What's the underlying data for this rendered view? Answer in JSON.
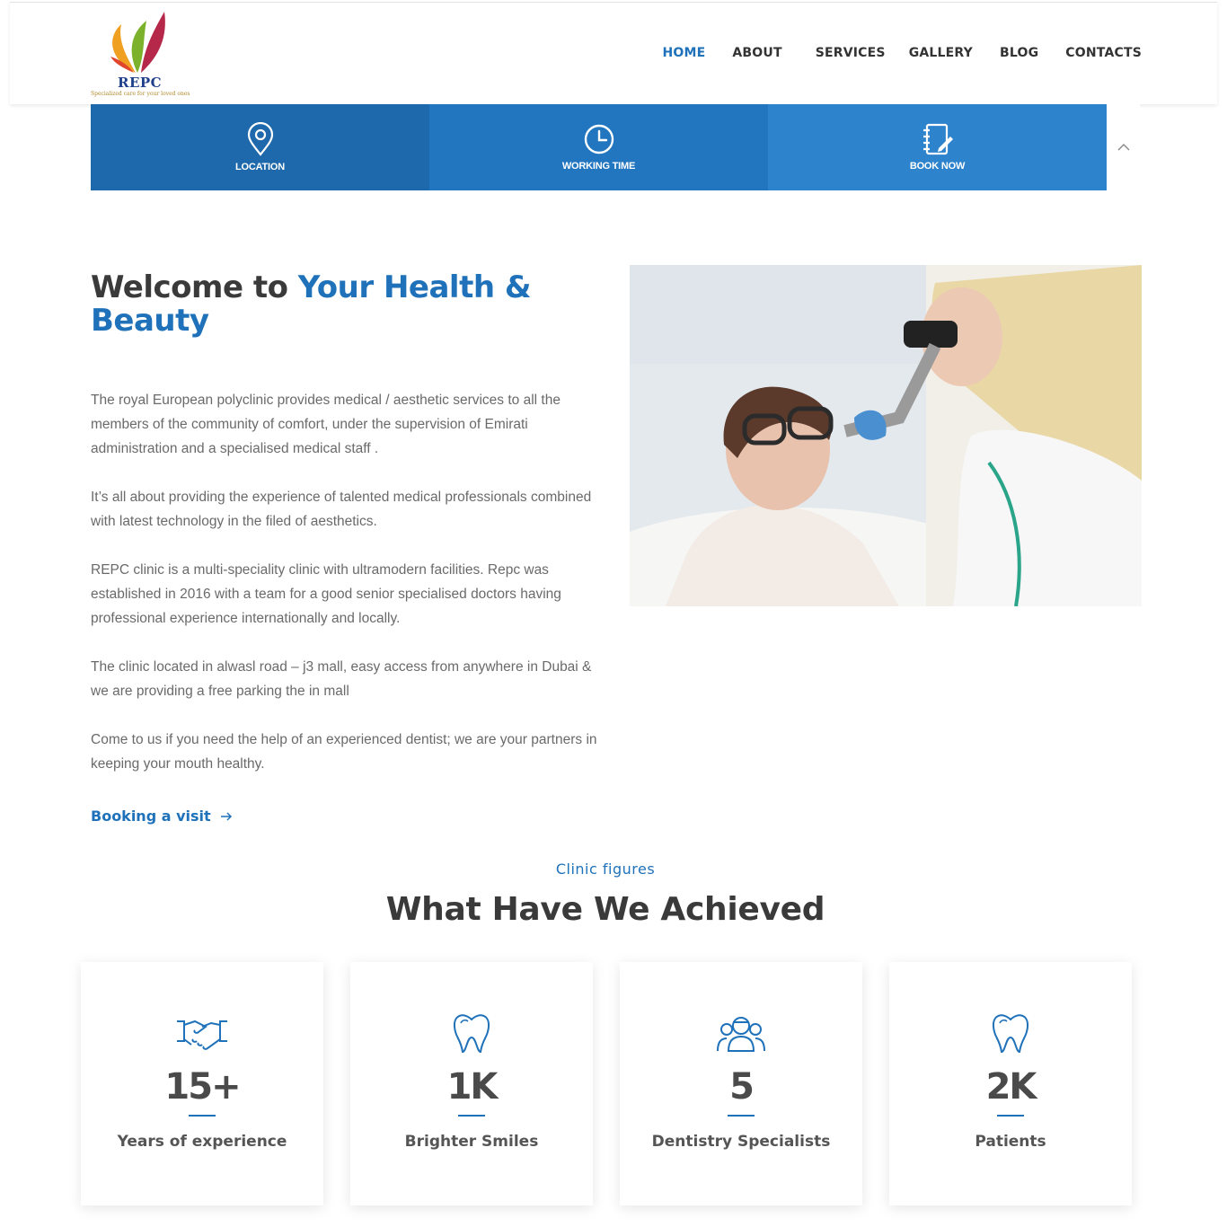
{
  "header": {
    "logo_name": "REPC",
    "logo_tagline": "Specialized care for your loved ones",
    "nav": [
      {
        "label": "HOME",
        "active": true
      },
      {
        "label": "ABOUT",
        "active": false
      },
      {
        "label": "SERVICES",
        "active": false
      },
      {
        "label": "GALLERY",
        "active": false
      },
      {
        "label": "BLOG",
        "active": false
      },
      {
        "label": "CONTACTS",
        "active": false
      }
    ]
  },
  "infobar": {
    "items": [
      {
        "label": "LOCATION",
        "icon": "location-pin-icon"
      },
      {
        "label": "WORKING TIME",
        "icon": "clock-icon"
      },
      {
        "label": "BOOK NOW",
        "icon": "notebook-edit-icon"
      }
    ],
    "scroll_icon": "chevron-up-icon"
  },
  "about": {
    "title_plain": "Welcome to ",
    "title_highlight": "Your Health & Beauty",
    "paragraphs": [
      "The royal European polyclinic provides medical / aesthetic services to all the members of the community of comfort, under the supervision of Emirati administration and a specialised medical staff .",
      "It’s all about providing the experience of talented medical professionals combined with latest technology in the filed of aesthetics.",
      "REPC clinic is a multi-speciality clinic with ultramodern facilities. Repc was established in 2016 with a team for a good senior specialised doctors having professional experience internationally and locally.",
      "The clinic located in alwasl road – j3 mall, easy access from anywhere in Dubai & we are providing a free parking the in mall",
      "Come to us if you need the help of an experienced dentist; we are your partners in keeping your mouth healthy."
    ],
    "cta_label": "Booking a visit",
    "cta_icon": "arrow-right-icon"
  },
  "figures": {
    "kicker": "Clinic figures",
    "title": "What Have We Achieved",
    "cards": [
      {
        "value": "15+",
        "label": "Years of experience",
        "icon": "handshake-icon"
      },
      {
        "value": "1K",
        "label": "Brighter Smiles",
        "icon": "tooth-icon"
      },
      {
        "value": "5",
        "label": "Dentistry Specialists",
        "icon": "doctors-team-icon"
      },
      {
        "value": "2K",
        "label": "Patients",
        "icon": "tooth-icon"
      }
    ]
  },
  "colors": {
    "accent": "#1f72ba",
    "infobar_1": "#1d69ab",
    "infobar_2": "#2276c0",
    "infobar_3": "#2d83cc"
  }
}
